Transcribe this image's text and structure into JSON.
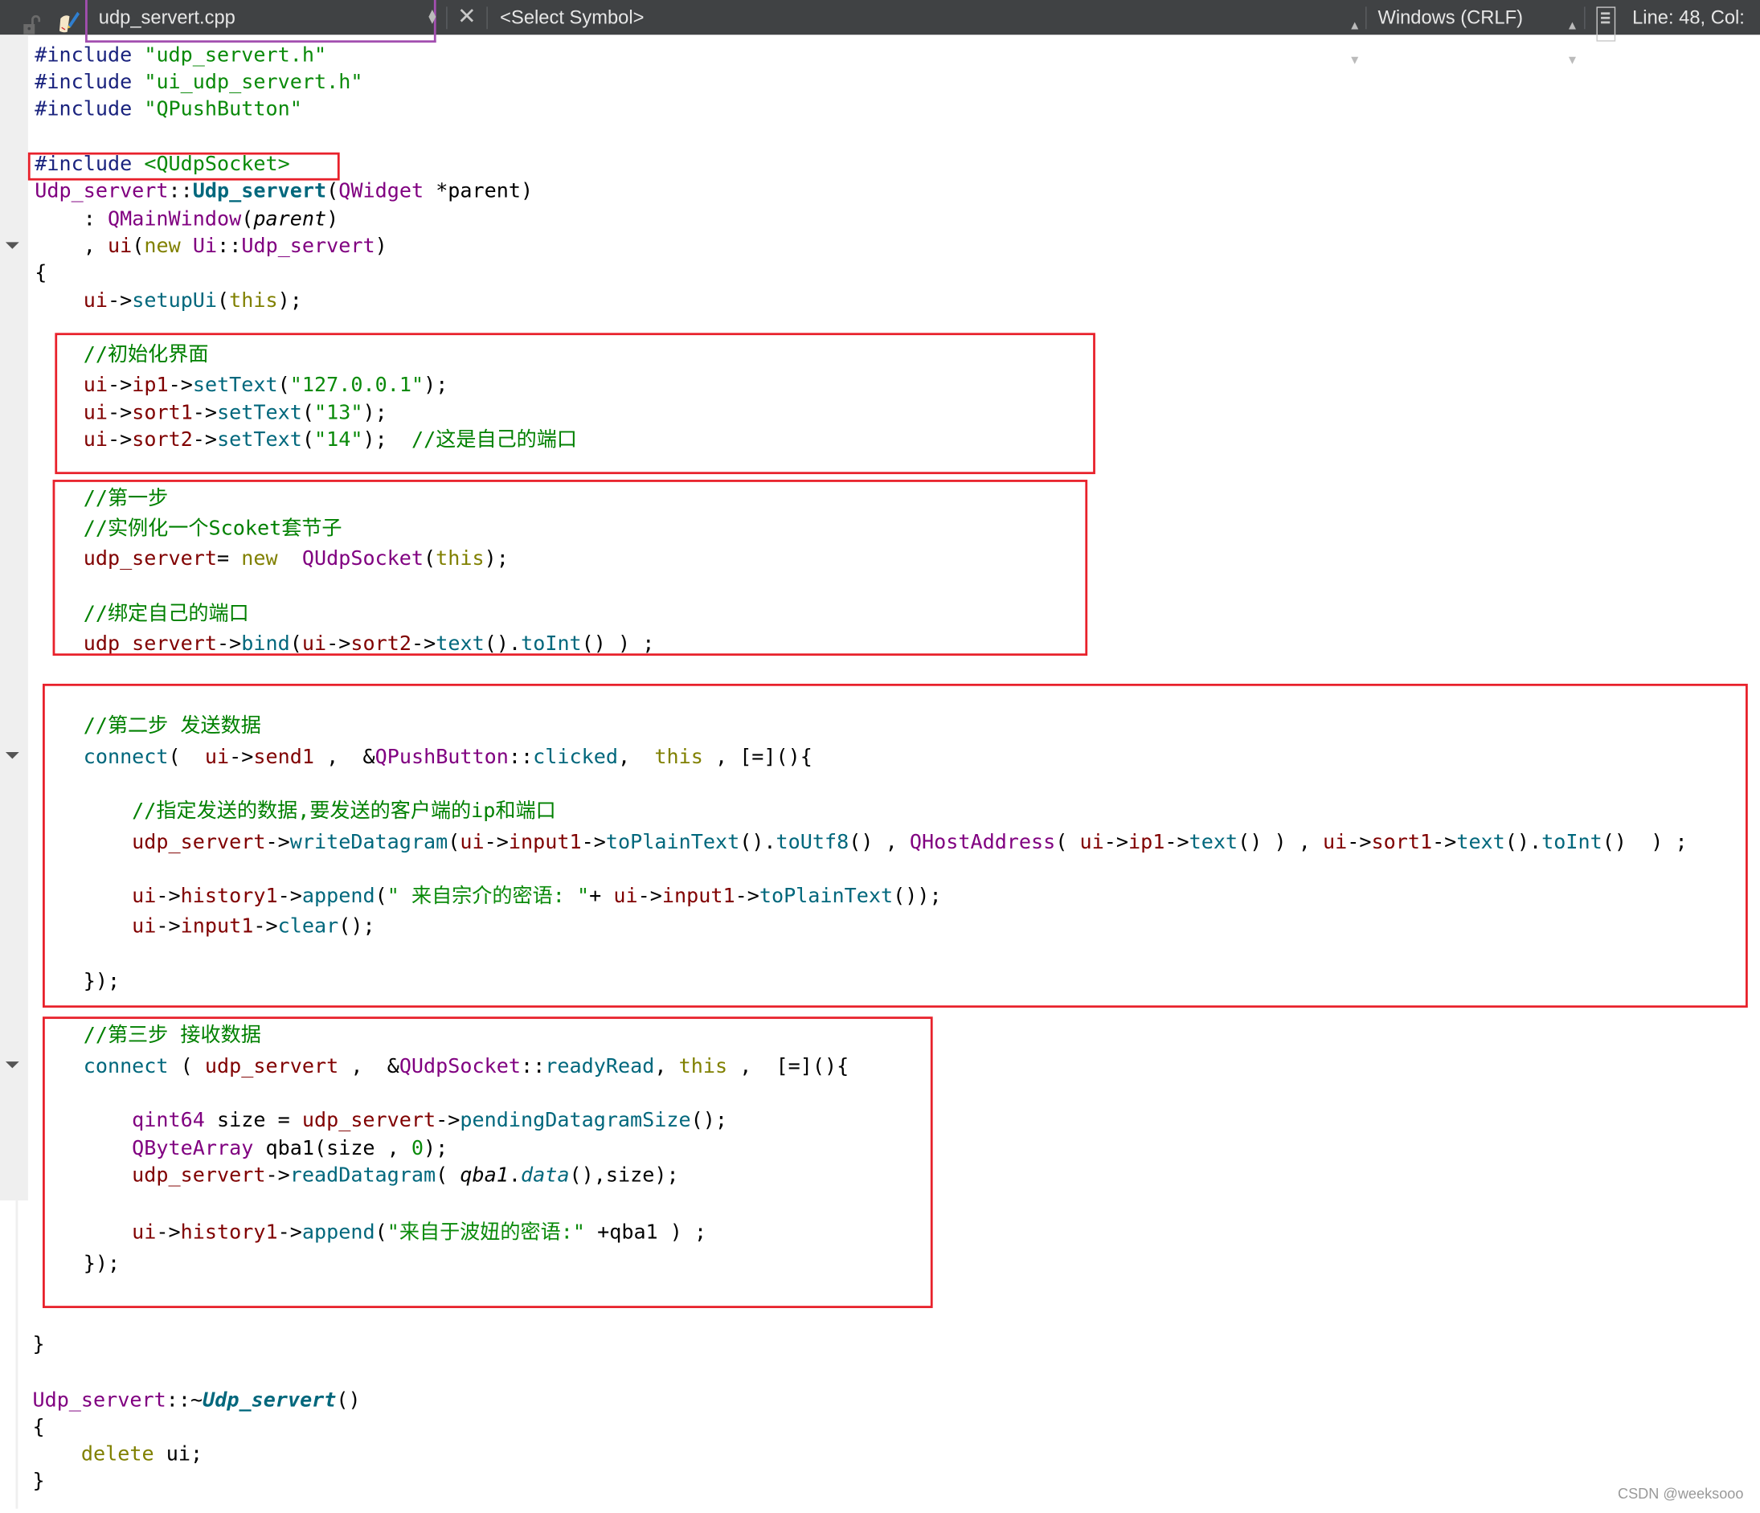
{
  "toolbar": {
    "file_name": "udp_servert.cpp",
    "symbol": "<Select Symbol>",
    "encoding": "Windows (CRLF)",
    "position": "Line: 48, Col:",
    "close_glyph": "✕",
    "updown_glyph": "▲▼"
  },
  "editor": {
    "lines": [
      {
        "tokens": [
          [
            "kw",
            "#include "
          ],
          [
            "str",
            "\"udp_servert.h\""
          ]
        ]
      },
      {
        "tokens": [
          [
            "kw",
            "#include "
          ],
          [
            "str",
            "\"ui_udp_servert.h\""
          ]
        ]
      },
      {
        "tokens": [
          [
            "kw",
            "#include "
          ],
          [
            "str",
            "\"QPushButton\""
          ]
        ]
      },
      {
        "tokens": []
      },
      {
        "tokens": [
          [
            "kw",
            "#include "
          ],
          [
            "str",
            "<QUdpSocket>"
          ]
        ]
      },
      {
        "tokens": [
          [
            "cls",
            "Udp_servert"
          ],
          [
            "plain",
            "::"
          ],
          [
            "fn bold",
            "Udp_servert"
          ],
          [
            "plain",
            "("
          ],
          [
            "cls",
            "QWidget"
          ],
          [
            "plain",
            " *parent)"
          ]
        ]
      },
      {
        "tokens": [
          [
            "plain",
            "    : "
          ],
          [
            "cls",
            "QMainWindow"
          ],
          [
            "plain",
            "("
          ],
          [
            "plain ital",
            "parent"
          ],
          [
            "plain",
            ")"
          ]
        ]
      },
      {
        "tokens": [
          [
            "plain",
            "    , "
          ],
          [
            "mem",
            "ui"
          ],
          [
            "plain",
            "("
          ],
          [
            "key",
            "new "
          ],
          [
            "cls",
            "Ui"
          ],
          [
            "plain",
            "::"
          ],
          [
            "cls",
            "Udp_servert"
          ],
          [
            "plain",
            ")"
          ]
        ]
      },
      {
        "tokens": [
          [
            "plain",
            "{"
          ]
        ]
      },
      {
        "tokens": [
          [
            "mem",
            "    ui"
          ],
          [
            "plain",
            "->"
          ],
          [
            "fn",
            "setupUi"
          ],
          [
            "plain",
            "("
          ],
          [
            "key",
            "this"
          ],
          [
            "plain",
            ");"
          ]
        ]
      },
      {
        "tokens": []
      },
      {
        "tokens": [
          [
            "cm",
            "    //初始化界面"
          ]
        ]
      },
      {
        "tokens": [
          [
            "mem",
            "    ui"
          ],
          [
            "plain",
            "->"
          ],
          [
            "mem",
            "ip1"
          ],
          [
            "plain",
            "->"
          ],
          [
            "fn",
            "setText"
          ],
          [
            "plain",
            "("
          ],
          [
            "str",
            "\"127.0.0.1\""
          ],
          [
            "plain",
            ");"
          ]
        ]
      },
      {
        "tokens": [
          [
            "mem",
            "    ui"
          ],
          [
            "plain",
            "->"
          ],
          [
            "mem",
            "sort1"
          ],
          [
            "plain",
            "->"
          ],
          [
            "fn",
            "setText"
          ],
          [
            "plain",
            "("
          ],
          [
            "str",
            "\"13\""
          ],
          [
            "plain",
            ");"
          ]
        ]
      },
      {
        "tokens": [
          [
            "mem",
            "    ui"
          ],
          [
            "plain",
            "->"
          ],
          [
            "mem",
            "sort2"
          ],
          [
            "plain",
            "->"
          ],
          [
            "fn",
            "setText"
          ],
          [
            "plain",
            "("
          ],
          [
            "str",
            "\"14\""
          ],
          [
            "plain",
            ");  "
          ],
          [
            "cm",
            "//这是自己的端口"
          ]
        ]
      },
      {
        "tokens": [
          [
            "cm",
            "    //第一步"
          ]
        ]
      },
      {
        "tokens": [
          [
            "cm",
            "    //实例化一个Scoket套节子"
          ]
        ]
      },
      {
        "tokens": [
          [
            "mem",
            "    udp_servert"
          ],
          [
            "plain",
            "= "
          ],
          [
            "key",
            "new  "
          ],
          [
            "cls",
            "QUdpSocket"
          ],
          [
            "plain",
            "("
          ],
          [
            "key",
            "this"
          ],
          [
            "plain",
            ");"
          ]
        ]
      },
      {
        "tokens": []
      },
      {
        "tokens": [
          [
            "cm",
            "    //绑定自己的端口"
          ]
        ]
      },
      {
        "tokens": [
          [
            "mem",
            "    udp_servert"
          ],
          [
            "plain",
            "->"
          ],
          [
            "fn",
            "bind"
          ],
          [
            "plain",
            "("
          ],
          [
            "mem",
            "ui"
          ],
          [
            "plain",
            "->"
          ],
          [
            "mem",
            "sort2"
          ],
          [
            "plain",
            "->"
          ],
          [
            "fn",
            "text"
          ],
          [
            "plain",
            "()."
          ],
          [
            "fn",
            "toInt"
          ],
          [
            "plain",
            "() ) ;"
          ]
        ]
      },
      {
        "tokens": [
          [
            "cm",
            "    //第二步 发送数据"
          ]
        ]
      },
      {
        "tokens": [
          [
            "fn",
            "    connect"
          ],
          [
            "plain",
            "(  "
          ],
          [
            "mem",
            "ui"
          ],
          [
            "plain",
            "->"
          ],
          [
            "mem",
            "send1"
          ],
          [
            "plain",
            " ,  &"
          ],
          [
            "cls",
            "QPushButton"
          ],
          [
            "plain",
            "::"
          ],
          [
            "fn",
            "clicked"
          ],
          [
            "plain",
            ",  "
          ],
          [
            "key",
            "this"
          ],
          [
            "plain",
            " , [=](){"
          ]
        ]
      },
      {
        "tokens": []
      },
      {
        "tokens": [
          [
            "cm",
            "        //指定发送的数据,要发送的客户端的ip和端口"
          ]
        ]
      },
      {
        "tokens": [
          [
            "mem",
            "        udp_servert"
          ],
          [
            "plain",
            "->"
          ],
          [
            "fn",
            "writeDatagram"
          ],
          [
            "plain",
            "("
          ],
          [
            "mem",
            "ui"
          ],
          [
            "plain",
            "->"
          ],
          [
            "mem",
            "input1"
          ],
          [
            "plain",
            "->"
          ],
          [
            "fn",
            "toPlainText"
          ],
          [
            "plain",
            "()."
          ],
          [
            "fn",
            "toUtf8"
          ],
          [
            "plain",
            "() , "
          ],
          [
            "cls",
            "QHostAddress"
          ],
          [
            "plain",
            "( "
          ],
          [
            "mem",
            "ui"
          ],
          [
            "plain",
            "->"
          ],
          [
            "mem",
            "ip1"
          ],
          [
            "plain",
            "->"
          ],
          [
            "fn",
            "text"
          ],
          [
            "plain",
            "() ) , "
          ],
          [
            "mem",
            "ui"
          ],
          [
            "plain",
            "->"
          ],
          [
            "mem",
            "sort1"
          ],
          [
            "plain",
            "->"
          ],
          [
            "fn",
            "text"
          ],
          [
            "plain",
            "()."
          ],
          [
            "fn",
            "toInt"
          ],
          [
            "plain",
            "()  ) ;"
          ]
        ]
      },
      {
        "tokens": []
      },
      {
        "tokens": [
          [
            "mem",
            "        ui"
          ],
          [
            "plain",
            "->"
          ],
          [
            "mem",
            "history1"
          ],
          [
            "plain",
            "->"
          ],
          [
            "fn",
            "append"
          ],
          [
            "plain",
            "("
          ],
          [
            "str",
            "\" 来自宗介的密语: \""
          ],
          [
            "plain",
            "+ "
          ],
          [
            "mem",
            "ui"
          ],
          [
            "plain",
            "->"
          ],
          [
            "mem",
            "input1"
          ],
          [
            "plain",
            "->"
          ],
          [
            "fn",
            "toPlainText"
          ],
          [
            "plain",
            "());"
          ]
        ]
      },
      {
        "tokens": [
          [
            "mem",
            "        ui"
          ],
          [
            "plain",
            "->"
          ],
          [
            "mem",
            "input1"
          ],
          [
            "plain",
            "->"
          ],
          [
            "fn",
            "clear"
          ],
          [
            "plain",
            "();"
          ]
        ]
      },
      {
        "tokens": []
      },
      {
        "tokens": [
          [
            "plain",
            "    });"
          ]
        ]
      },
      {
        "tokens": [
          [
            "cm",
            "    //第三步 接收数据"
          ]
        ]
      },
      {
        "tokens": [
          [
            "fn",
            "    connect"
          ],
          [
            "plain",
            " ( "
          ],
          [
            "mem",
            "udp_servert"
          ],
          [
            "plain",
            " ,  &"
          ],
          [
            "cls",
            "QUdpSocket"
          ],
          [
            "plain",
            "::"
          ],
          [
            "fn",
            "readyRead"
          ],
          [
            "plain",
            ", "
          ],
          [
            "key",
            "this"
          ],
          [
            "plain",
            " ,  [=](){"
          ]
        ]
      },
      {
        "tokens": []
      },
      {
        "tokens": [
          [
            "cls",
            "        qint64"
          ],
          [
            "plain",
            " size = "
          ],
          [
            "mem",
            "udp_servert"
          ],
          [
            "plain",
            "->"
          ],
          [
            "fn",
            "pendingDatagramSize"
          ],
          [
            "plain",
            "();"
          ]
        ]
      },
      {
        "tokens": [
          [
            "cls",
            "        QByteArray"
          ],
          [
            "plain",
            " qba1(size , "
          ],
          [
            "str",
            "0"
          ],
          [
            "plain",
            ");"
          ]
        ]
      },
      {
        "tokens": [
          [
            "mem",
            "        udp_servert"
          ],
          [
            "plain",
            "->"
          ],
          [
            "fn",
            "readDatagram"
          ],
          [
            "plain",
            "( "
          ],
          [
            "plain ital",
            "qba1"
          ],
          [
            "plain",
            "."
          ],
          [
            "fn ital",
            "data"
          ],
          [
            "plain",
            "(),size);"
          ]
        ]
      },
      {
        "tokens": []
      },
      {
        "tokens": [
          [
            "mem",
            "        ui"
          ],
          [
            "plain",
            "->"
          ],
          [
            "mem",
            "history1"
          ],
          [
            "plain",
            "->"
          ],
          [
            "fn",
            "append"
          ],
          [
            "plain",
            "("
          ],
          [
            "str",
            "\"来自于波妞的密语:\""
          ],
          [
            "plain",
            " +qba1 ) ;"
          ]
        ]
      },
      {
        "tokens": [
          [
            "plain",
            "    });"
          ]
        ]
      },
      {
        "tokens": []
      },
      {
        "tokens": [
          [
            "plain",
            "}"
          ]
        ]
      },
      {
        "tokens": []
      },
      {
        "tokens": [
          [
            "cls",
            "Udp_servert"
          ],
          [
            "plain",
            "::~"
          ],
          [
            "fn bold ital",
            "Udp_servert"
          ],
          [
            "plain",
            "()"
          ]
        ]
      },
      {
        "tokens": [
          [
            "plain",
            "{"
          ]
        ]
      },
      {
        "tokens": [
          [
            "key",
            "    delete "
          ],
          [
            "plain",
            "ui;"
          ]
        ]
      },
      {
        "tokens": [
          [
            "plain",
            "}"
          ]
        ]
      }
    ]
  },
  "watermark": "CSDN @weeksooo"
}
